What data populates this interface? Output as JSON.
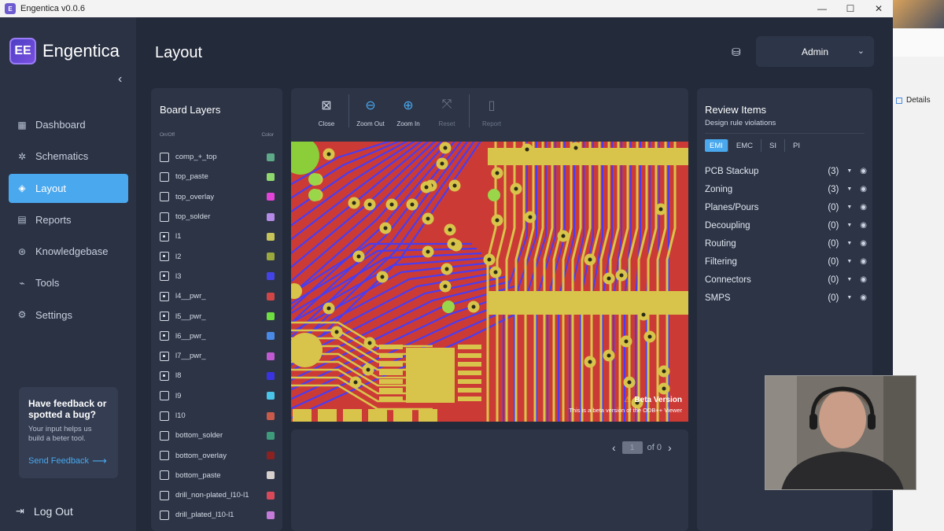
{
  "window": {
    "title": "Engentica v0.0.6",
    "icon": "E",
    "min": "—",
    "max": "☐",
    "close": "✕"
  },
  "brand": {
    "name": "Engentica",
    "logo_letters": "EE"
  },
  "sidebar": {
    "collapse_glyph": "‹",
    "items": [
      {
        "label": "Dashboard",
        "icon": "grid-icon",
        "glyph": "▦"
      },
      {
        "label": "Schematics",
        "icon": "hub-icon",
        "glyph": "✲"
      },
      {
        "label": "Layout",
        "icon": "layers-icon",
        "glyph": "◈",
        "active": true
      },
      {
        "label": "Reports",
        "icon": "report-icon",
        "glyph": "▤"
      },
      {
        "label": "Knowledgebase",
        "icon": "book-icon",
        "glyph": "⊛"
      },
      {
        "label": "Tools",
        "icon": "tools-icon",
        "glyph": "⌁"
      },
      {
        "label": "Settings",
        "icon": "gear-icon",
        "glyph": "⚙"
      }
    ],
    "feedback": {
      "title": "Have feedback or spotted a bug?",
      "text": "Your input helps us build a beter tool.",
      "link": "Send Feedback",
      "link_arrow": "⟶"
    },
    "logout": {
      "label": "Log Out",
      "glyph": "⇥"
    }
  },
  "header": {
    "title": "Layout",
    "db_glyph": "⛁",
    "user": "Admin",
    "user_chevron": "⌄"
  },
  "layers": {
    "title": "Board Layers",
    "col_onoff": "On/Off",
    "col_color": "Color",
    "items": [
      {
        "name": "comp_+_top",
        "on": false,
        "color": "#5fa888"
      },
      {
        "name": "top_paste",
        "on": false,
        "color": "#8fd86e"
      },
      {
        "name": "top_overlay",
        "on": false,
        "color": "#e244d8"
      },
      {
        "name": "top_solder",
        "on": false,
        "color": "#b48ae6"
      },
      {
        "name": "l1",
        "on": true,
        "color": "#c7c45a"
      },
      {
        "name": "l2",
        "on": true,
        "color": "#9aa83e"
      },
      {
        "name": "l3",
        "on": true,
        "color": "#4444e6"
      },
      {
        "name": "l4__pwr_",
        "on": true,
        "color": "#d04646"
      },
      {
        "name": "l5__pwr_",
        "on": true,
        "color": "#6ede42"
      },
      {
        "name": "l6__pwr_",
        "on": true,
        "color": "#4a8ae6"
      },
      {
        "name": "l7__pwr_",
        "on": true,
        "color": "#c05ad0"
      },
      {
        "name": "l8",
        "on": true,
        "color": "#3a34e0"
      },
      {
        "name": "l9",
        "on": false,
        "color": "#4ac4e8"
      },
      {
        "name": "l10",
        "on": false,
        "color": "#c85a4a"
      },
      {
        "name": "bottom_solder",
        "on": false,
        "color": "#3e9a7a"
      },
      {
        "name": "bottom_overlay",
        "on": false,
        "color": "#8a2222"
      },
      {
        "name": "bottom_paste",
        "on": false,
        "color": "#d8d0cc"
      },
      {
        "name": "drill_non-plated_l10-l1",
        "on": false,
        "color": "#d84a5a"
      },
      {
        "name": "drill_plated_l10-l1",
        "on": false,
        "color": "#c47ad8"
      }
    ]
  },
  "toolbar": {
    "tools": [
      {
        "label": "Close",
        "icon": "close-box-icon",
        "glyph": "⊠"
      },
      {
        "label": "Zoom Out",
        "icon": "zoom-out-icon",
        "glyph": "⊖"
      },
      {
        "label": "Zoom In",
        "icon": "zoom-in-icon",
        "glyph": "⊕"
      },
      {
        "label": "Reset",
        "icon": "reset-icon",
        "glyph": "⤧",
        "disabled": true
      },
      {
        "label": "Report",
        "icon": "clipboard-icon",
        "glyph": "▯",
        "disabled": true
      }
    ]
  },
  "viewer": {
    "beta_title": "Beta Version",
    "beta_icon": "⚠",
    "beta_text": "This is a beta version of the ODB++ Viewer"
  },
  "pager": {
    "prev": "‹",
    "page": "1",
    "of": "of 0",
    "next": "›"
  },
  "review": {
    "title": "Review Items",
    "subtitle": "Design rule violations",
    "tabs": [
      "EMI",
      "EMC",
      "SI",
      "PI"
    ],
    "active_tab": "EMI",
    "caret": "▼",
    "eye": "◉",
    "items": [
      {
        "name": "PCB Stackup",
        "count": "(3)"
      },
      {
        "name": "Zoning",
        "count": "(3)"
      },
      {
        "name": "Planes/Pours",
        "count": "(0)"
      },
      {
        "name": "Decoupling",
        "count": "(0)"
      },
      {
        "name": "Routing",
        "count": "(0)"
      },
      {
        "name": "Filtering",
        "count": "(0)"
      },
      {
        "name": "Connectors",
        "count": "(0)"
      },
      {
        "name": "SMPS",
        "count": "(0)"
      }
    ]
  },
  "background_window": {
    "details_label": "Details"
  }
}
